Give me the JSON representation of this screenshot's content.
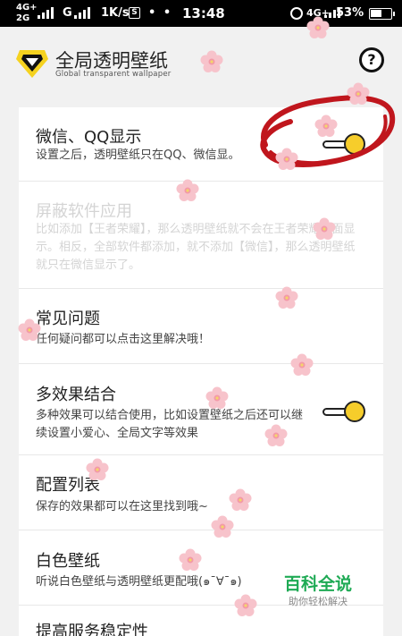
{
  "status_bar": {
    "net1_top": "4G+",
    "net1_bottom": "2G",
    "carrier_g": "G",
    "speed": "1K/s",
    "s_badge": "S",
    "time": "13:48",
    "net2": "4G+",
    "battery": "53%"
  },
  "header": {
    "title": "全局透明壁纸",
    "subtitle": "Global transparent wallpaper",
    "help": "?"
  },
  "items": [
    {
      "title": "微信、QQ显示",
      "desc": "设置之后，透明壁纸只在QQ、微信显。"
    },
    {
      "title": "屏蔽软件应用",
      "desc": "比如添加【王者荣耀】，那么透明壁纸就不会在王者荣耀上面显示。相反，全部软件都添加，就不添加【微信】，那么透明壁纸就只在微信显示了。"
    },
    {
      "title": "常见问题",
      "desc": "任何疑问都可以点击这里解决哦！"
    },
    {
      "title": "多效果结合",
      "desc": "多种效果可以结合使用，比如设置壁纸之后还可以继续设置小爱心、全局文字等效果"
    },
    {
      "title": "配置列表",
      "desc": "保存的效果都可以在这里找到哦~"
    },
    {
      "title": "白色壁纸",
      "desc": "听说白色壁纸与透明壁纸更配哦(๑¯∀¯๑)"
    },
    {
      "title": "提高服务稳定性",
      "desc": ""
    }
  ],
  "toggles": {
    "wechat_qq": "on",
    "multi_effect": "on"
  },
  "watermark": {
    "main": "百科全说",
    "sub": "助你轻松解决"
  },
  "colors": {
    "toggle_knob": "#f6cd2b",
    "annotation": "#c0161d",
    "watermark": "#1faa55"
  }
}
